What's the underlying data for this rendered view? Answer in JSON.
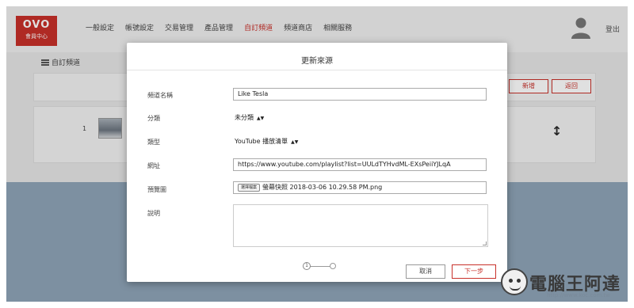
{
  "header": {
    "logo_text": "OVO",
    "logo_sub": "會員中心",
    "nav": [
      {
        "label": "一般設定",
        "active": false
      },
      {
        "label": "帳號設定",
        "active": false
      },
      {
        "label": "交易管理",
        "active": false
      },
      {
        "label": "產品管理",
        "active": false
      },
      {
        "label": "自訂頻道",
        "active": true
      },
      {
        "label": "頻道商店",
        "active": false
      },
      {
        "label": "相關服務",
        "active": false
      }
    ],
    "logout_label": "登出"
  },
  "page": {
    "section_title": "自訂頻道",
    "add_button": "新增",
    "back_button": "返回",
    "row_number": "1"
  },
  "modal": {
    "title": "更新來源",
    "fields": {
      "name_label": "頻道名稱",
      "name_value": "Like Tesla",
      "category_label": "分類",
      "category_value": "未分類",
      "type_label": "類型",
      "type_value": "YouTube 播放清單",
      "url_label": "網址",
      "url_value": "https://www.youtube.com/playlist?list=UULdTYHvdML-EXsPeiiYJLqA",
      "preview_label": "預覽圖",
      "file_button": "選擇檔案",
      "file_name": "螢幕快照 2018-03-06 10.29.58 PM.png",
      "desc_label": "說明"
    },
    "step_indicator": "1",
    "cancel_button": "取消",
    "next_button": "下一步"
  },
  "watermark": {
    "text": "電腦王阿達",
    "url": "http://www.koc.com.tw"
  },
  "colors": {
    "brand_red": "#c8302a",
    "backdrop_blue": "#8fa4b8"
  }
}
